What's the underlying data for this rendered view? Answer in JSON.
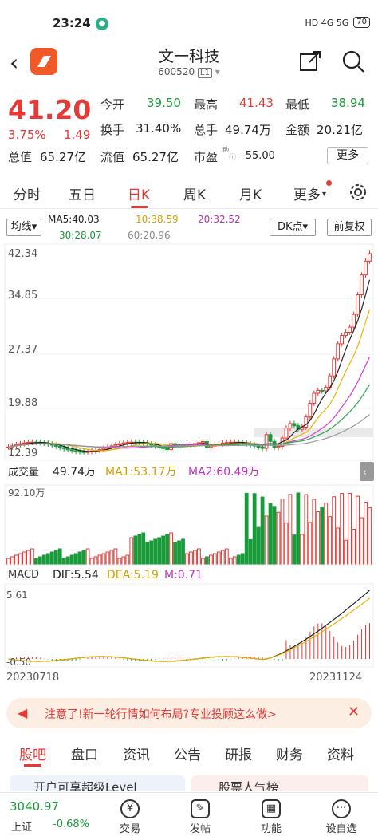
{
  "status": {
    "time": "23:24",
    "net": "HD 4G 5G",
    "battery": "70"
  },
  "nav": {
    "title": "文一科技",
    "code": "600520",
    "market_badge": "L1"
  },
  "quote": {
    "price": "41.20",
    "change_pct": "3.75%",
    "change": "1.49",
    "open_label": "今开",
    "open": "39.50",
    "high_label": "最高",
    "high": "41.43",
    "low_label": "最低",
    "low": "38.94",
    "turnover_label": "换手",
    "turnover": "31.40%",
    "volume_label": "总手",
    "volume": "49.74万",
    "amount_label": "金额",
    "amount": "20.21亿",
    "mcap_label": "总值",
    "mcap": "65.27亿",
    "float_label": "流值",
    "float_cap": "65.27亿",
    "pe_label": "市盈",
    "pe_sup": "动",
    "pe": "-55.00",
    "more": "更多"
  },
  "tabs": [
    "分时",
    "五日",
    "日K",
    "周K",
    "月K",
    "更多"
  ],
  "kbar": {
    "ma_type": "均线",
    "ma5": "MA5:40.03",
    "ma10": "10:38.59",
    "ma20": "20:32.52",
    "ma30": "30:28.07",
    "ma60": "60:20.96",
    "dk": "DK点",
    "fq": "前复权"
  },
  "axis": {
    "y1": "42.34",
    "y2": "34.85",
    "y3": "27.37",
    "y4": "19.88",
    "y5": "12.39",
    "vol_max": "92.10万",
    "macd_max": "5.61",
    "macd_min": "-0.50",
    "date_start": "20230718",
    "date_end": "20231124"
  },
  "volume": {
    "label": "成交量",
    "value": "49.74万",
    "ma1": "MA1:53.17万",
    "ma2": "MA2:60.49万"
  },
  "macd": {
    "label": "MACD",
    "dif": "DIF:5.54",
    "dea": "DEA:5.19",
    "m": "M:0.71"
  },
  "colors": {
    "up": "#e63a36",
    "down": "#1a9a3a",
    "ma5": "#222222",
    "ma10": "#e8b400",
    "ma20": "#d43bd4",
    "ma30": "#2aa84a",
    "ma60": "#999999"
  },
  "warn": {
    "text": "注意了!新一轮行情如何布局?专业投顾这么做>"
  },
  "subtabs": [
    "股吧",
    "盘口",
    "资讯",
    "公告",
    "研报",
    "财务",
    "资料"
  ],
  "promo": {
    "left": "开户可享超级Level",
    "right": "股票人气榜"
  },
  "bottom": {
    "index_value": "3040.97",
    "index_name": "上证",
    "index_change": "-0.68%",
    "items": [
      "交易",
      "发帖",
      "功能",
      "设自选"
    ]
  }
}
